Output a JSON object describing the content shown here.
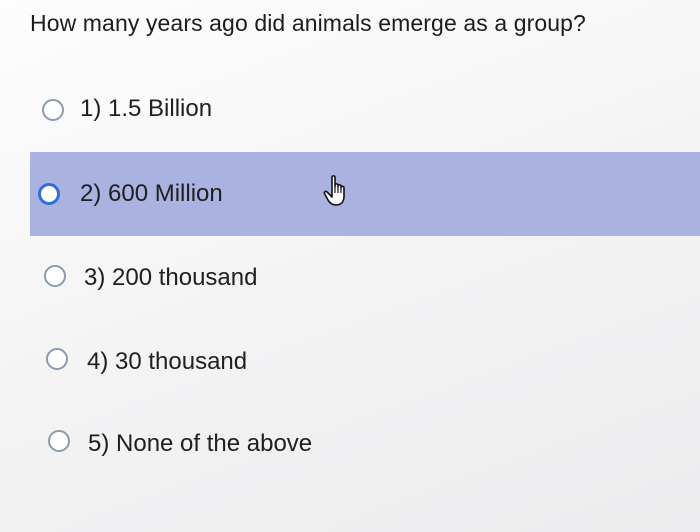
{
  "question": {
    "text": "How many years ago did animals emerge as a group?"
  },
  "options": [
    {
      "label": "1) 1.5 Billion",
      "selected": false
    },
    {
      "label": "2) 600 Million",
      "selected": true
    },
    {
      "label": "3) 200 thousand",
      "selected": false
    },
    {
      "label": "4) 30 thousand",
      "selected": false
    },
    {
      "label": "5) None of the above",
      "selected": false
    }
  ],
  "colors": {
    "selected_background": "#a9b2e0",
    "selected_radio": "#2f6fd6",
    "radio_border": "#8a9bb0"
  },
  "icons": {
    "cursor": "hand-pointer-icon"
  }
}
